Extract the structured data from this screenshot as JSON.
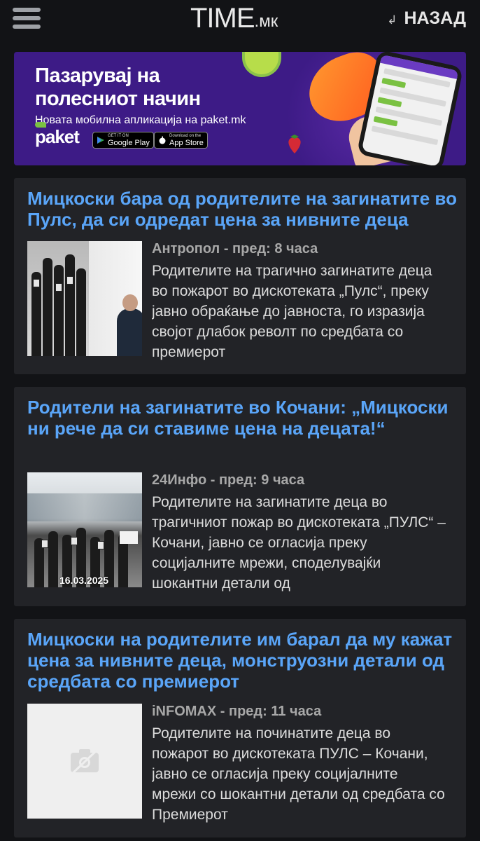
{
  "header": {
    "logo_main": "TIME",
    "logo_suffix": ".мк",
    "back_label": "НАЗАД",
    "back_arrow": "↲"
  },
  "banner": {
    "headline_line1": "Пазарувај на",
    "headline_line2": "полесниот начин",
    "subtitle": "Новата мобилна апликација на paket.mk",
    "brand": "paket",
    "google_top": "GET IT ON",
    "google_label": "Google Play",
    "apple_top": "Download on the",
    "apple_label": "App Store"
  },
  "articles": [
    {
      "title": "Мицкоски бара од родителите на загинатите во Пулс, да си одредат цена за нивните деца",
      "source": "Антропол",
      "time": "пред: 8 часа",
      "excerpt": "Родителите на трагично загинатите деца во пожарот во дискотеката „Пулс“, преку јавно обраќање до јавноста, го изразија својот длабок револт по средбата со премиерот"
    },
    {
      "title": "Родители на загинатите во Кочани: „Мицкоски ни рече да си ставиме цена на децата!“",
      "source": "24Инфо",
      "time": "пред: 9 часа",
      "excerpt": "Родителите на загинатите деца во трагичниот пожар во дискотеката „ПУЛС“ – Кочани, јавно се огласија преку социјалните мрежи, споделувајќи шокантни детали од",
      "image_caption": "16.03.2025"
    },
    {
      "title": "Мицкоски на родителите им барал да му кажат цена за нивните деца, монструозни детали од средбата со премиерот",
      "source": "iNFOMAX",
      "time": "пред: 11 часа",
      "excerpt": "Родителите на починатите деца во пожарот во дискотеката ПУЛС – Кочани, јавно се огласија преку социјалните мрежи со шокантни детали од средбата со Премиерот"
    }
  ],
  "colors": {
    "background": "#121316",
    "card": "#222327",
    "link": "#5aa5f8",
    "banner": "#3d1b86"
  }
}
